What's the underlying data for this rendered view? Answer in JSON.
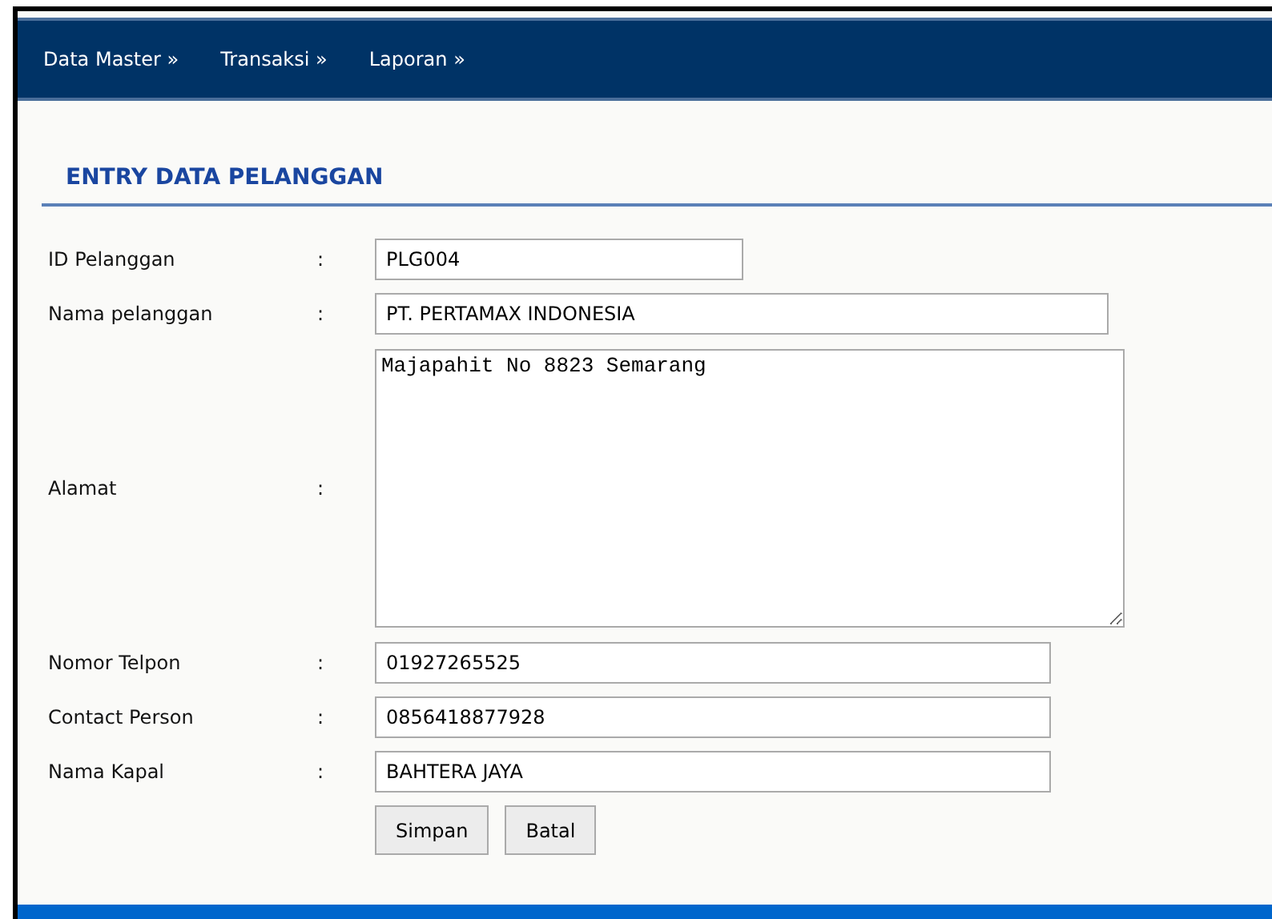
{
  "menu": [
    {
      "label": "Data Master »"
    },
    {
      "label": "Transaksi »"
    },
    {
      "label": "Laporan »"
    }
  ],
  "form": {
    "title": "ENTRY DATA PELANGGAN",
    "fields": [
      {
        "kind": "input",
        "label": "ID Pelanggan",
        "separator": ":",
        "value": "PLG004"
      },
      {
        "kind": "input",
        "label": "Nama pelanggan",
        "separator": ":",
        "value": "PT. PERTAMAX INDONESIA"
      },
      {
        "kind": "textarea",
        "label": "Alamat",
        "separator": ":",
        "value": "Majapahit No 8823 Semarang"
      },
      {
        "kind": "input",
        "label": "Nomor Telpon",
        "separator": ":",
        "value": "01927265525"
      },
      {
        "kind": "input",
        "label": "Contact Person",
        "separator": ":",
        "value": "0856418877928"
      },
      {
        "kind": "input",
        "label": "Nama Kapal",
        "separator": ":",
        "value": "BAHTERA JAYA"
      }
    ],
    "buttons": [
      {
        "label": "Simpan"
      },
      {
        "label": "Batal"
      }
    ]
  }
}
